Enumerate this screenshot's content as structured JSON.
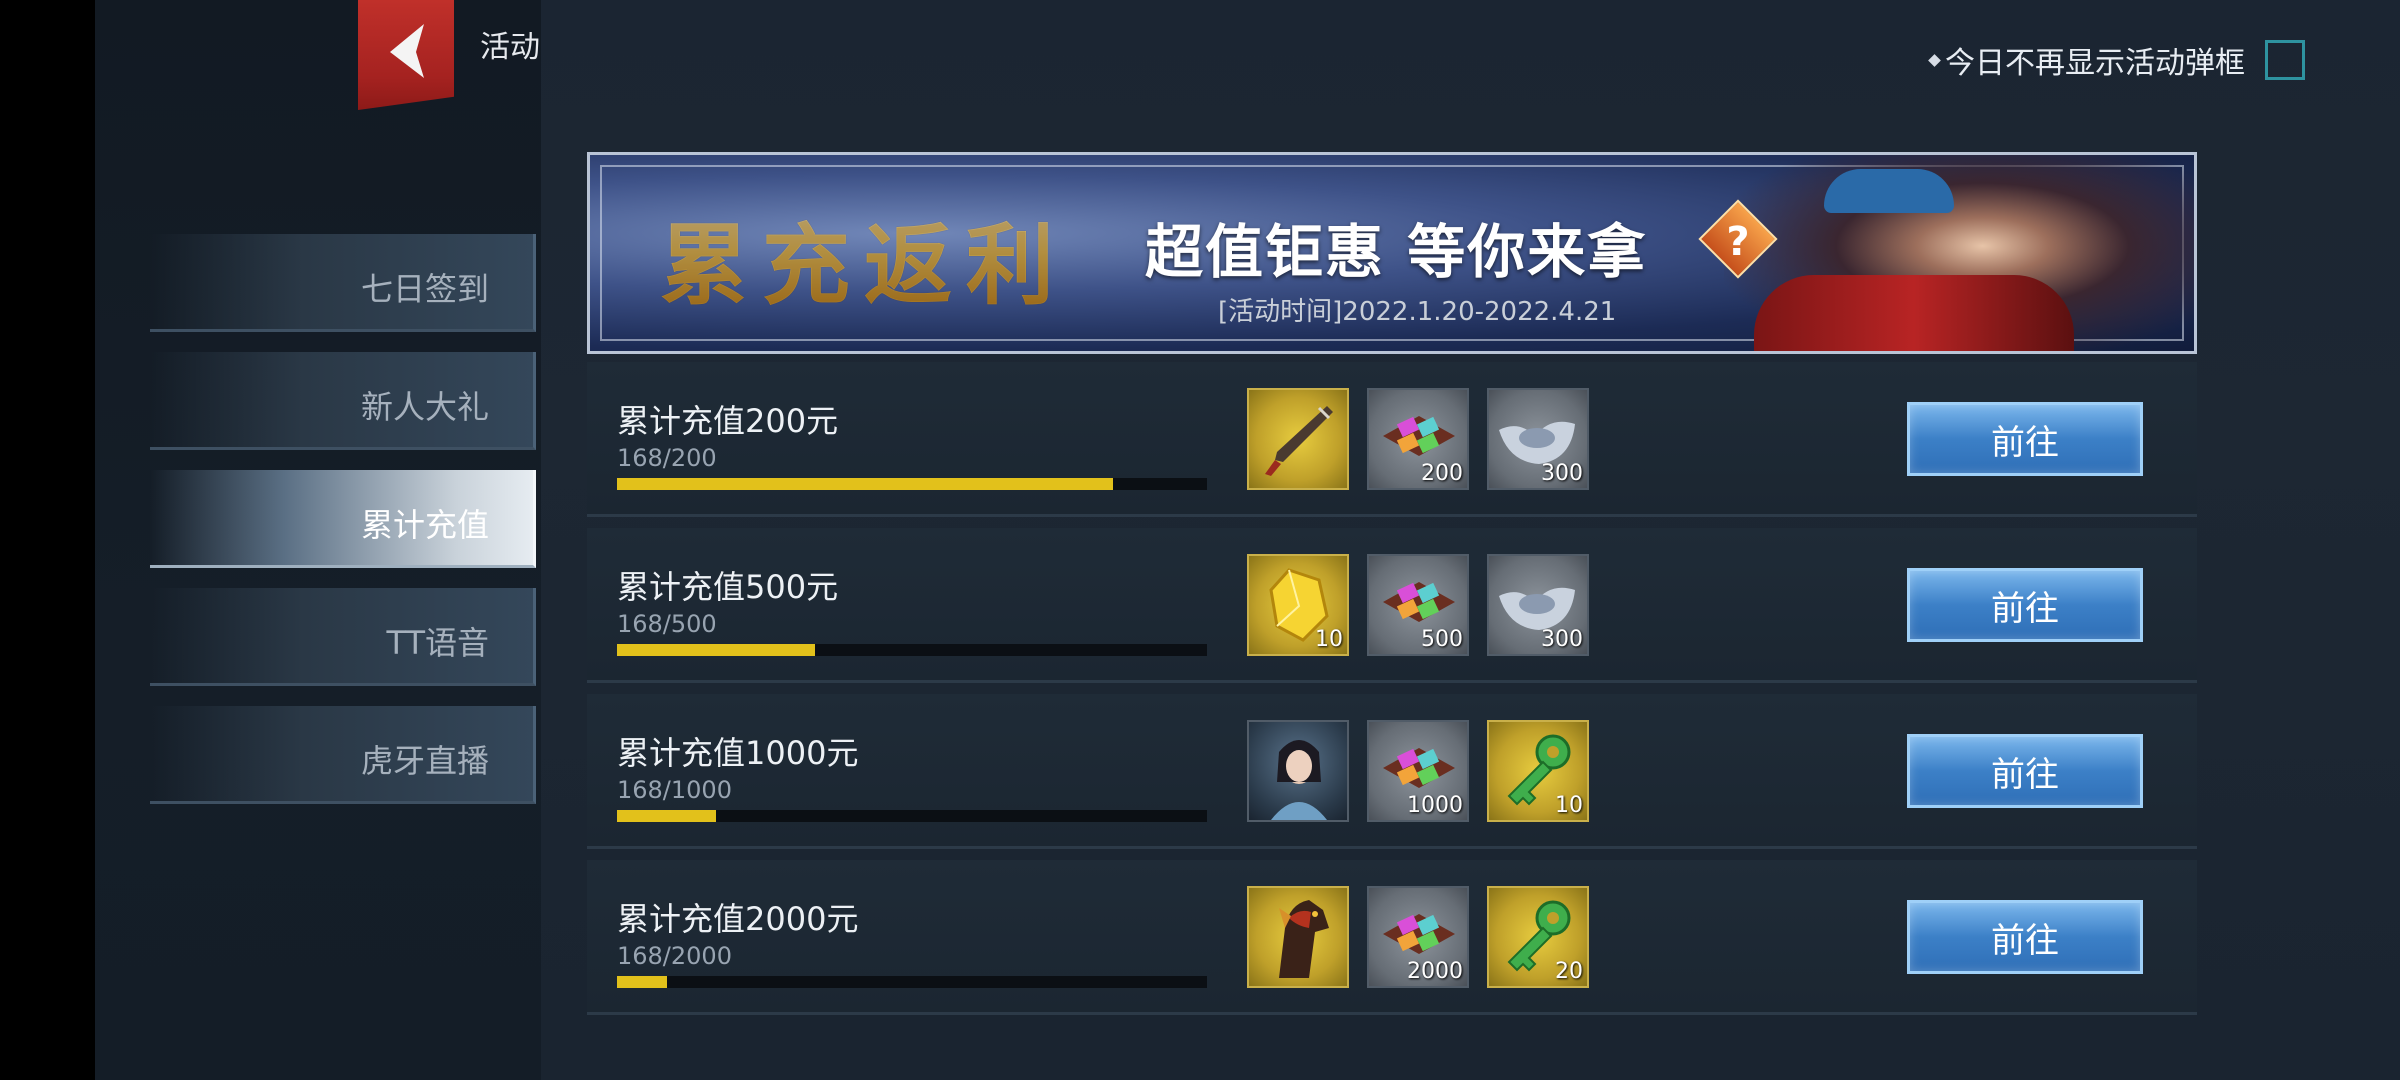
{
  "header": {
    "title": "活动",
    "hide_popup_label": "今日不再显示活动弹框",
    "hide_popup_checked": false
  },
  "sidebar": {
    "items": [
      {
        "label": "七日签到",
        "active": false
      },
      {
        "label": "新人大礼",
        "active": false
      },
      {
        "label": "累计充值",
        "active": true
      },
      {
        "label": "TT语音",
        "active": false
      },
      {
        "label": "虎牙直播",
        "active": false
      }
    ]
  },
  "banner": {
    "title": "累充返利",
    "slogan": "超值钜惠  等你来拿",
    "help_icon": "?",
    "date": "[活动时间]2022.1.20-2022.4.21"
  },
  "rows": [
    {
      "title": "累计充值200元",
      "progress_text": "168/200",
      "progress": 0.84,
      "button": "前往",
      "rewards": [
        {
          "icon": "dagger-icon",
          "qty": ""
        },
        {
          "icon": "gem-box-icon",
          "qty": "200"
        },
        {
          "icon": "silver-ingot-icon",
          "qty": "300"
        }
      ]
    },
    {
      "title": "累计充值500元",
      "progress_text": "168/500",
      "progress": 0.336,
      "button": "前往",
      "rewards": [
        {
          "icon": "yellow-crystal-icon",
          "qty": "10"
        },
        {
          "icon": "gem-box-icon",
          "qty": "500"
        },
        {
          "icon": "silver-ingot-icon",
          "qty": "300"
        }
      ]
    },
    {
      "title": "累计充值1000元",
      "progress_text": "168/1000",
      "progress": 0.168,
      "button": "前往",
      "rewards": [
        {
          "icon": "character-portrait-icon",
          "qty": ""
        },
        {
          "icon": "gem-box-icon",
          "qty": "1000"
        },
        {
          "icon": "green-key-icon",
          "qty": "10"
        }
      ]
    },
    {
      "title": "累计充值2000元",
      "progress_text": "168/2000",
      "progress": 0.084,
      "button": "前往",
      "rewards": [
        {
          "icon": "horse-mount-icon",
          "qty": ""
        },
        {
          "icon": "gem-box-icon",
          "qty": "2000"
        },
        {
          "icon": "green-key-icon",
          "qty": "20"
        }
      ]
    }
  ],
  "colors": {
    "progress_fill": "#e2c11b",
    "button_blue": "#3c80c7",
    "back_red": "#c0302a"
  }
}
